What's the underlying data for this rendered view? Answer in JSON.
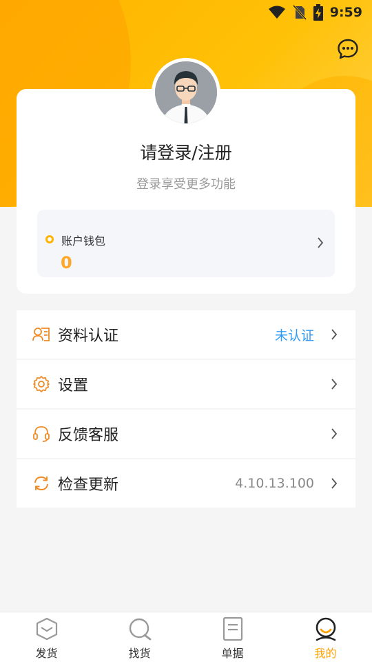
{
  "status_bar": {
    "time": "9:59"
  },
  "profile": {
    "title": "请登录/注册",
    "subtitle": "登录享受更多功能"
  },
  "wallet": {
    "label": "账户钱包",
    "value": "0"
  },
  "menu": [
    {
      "label": "资料认证",
      "value": "未认证",
      "value_style": "blue",
      "icon": "id-card-icon"
    },
    {
      "label": "设置",
      "value": "",
      "value_style": "",
      "icon": "gear-icon"
    },
    {
      "label": "反馈客服",
      "value": "",
      "value_style": "",
      "icon": "headset-icon"
    },
    {
      "label": "检查更新",
      "value": "4.10.13.100",
      "value_style": "gray",
      "icon": "refresh-icon"
    }
  ],
  "tabs": [
    {
      "label": "发货",
      "icon": "box-icon",
      "active": false
    },
    {
      "label": "找货",
      "icon": "search-icon",
      "active": false
    },
    {
      "label": "单据",
      "icon": "document-icon",
      "active": false
    },
    {
      "label": "我的",
      "icon": "user-icon",
      "active": true
    }
  ],
  "colors": {
    "accent": "#ffa000",
    "header": "#ffc107",
    "link_blue": "#2f9bf5",
    "menu_icon": "#f08a24"
  }
}
